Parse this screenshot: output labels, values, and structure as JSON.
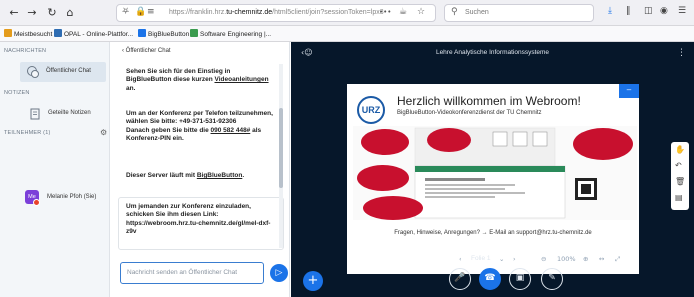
{
  "browser": {
    "back_icon": "arrow-left-icon",
    "forward_icon": "arrow-right-icon",
    "reload_icon": "reload-icon",
    "home_icon": "home-icon",
    "url_prefix": "https://franklin.hrz.",
    "url_domain": "tu-chemnitz.de",
    "url_rest": "/html5client/join?sessionToken=lpx3",
    "url_more": "•••",
    "search_placeholder": "Suchen",
    "bookmarks": [
      {
        "label": "Meistbesucht",
        "color": "#e49c1c"
      },
      {
        "label": "OPAL - Online-Plattfor...",
        "color": "#2f6db3"
      },
      {
        "label": "BigBlueButton",
        "color": "#1b73e8"
      },
      {
        "label": "Software Engineering |...",
        "color": "#3a9b4f"
      }
    ]
  },
  "sidebar": {
    "messages_header": "NACHRICHTEN",
    "public_chat_label": "Öffentlicher Chat",
    "notes_header": "NOTIZEN",
    "shared_notes_label": "Geteilte Notizen",
    "participants_header": "TEILNEHMER (1)",
    "user_initials": "Me",
    "user_name": "Melanie Pfoh (Sie)"
  },
  "chat": {
    "back_label": "‹  Öffentlicher Chat",
    "welcome_1": "Sehen Sie sich für den Einstieg in BigBlueButton diese kurzen ",
    "welcome_link": "Videoanleitungen",
    "welcome_2": " an.",
    "phone_1": "Um an der Konferenz per Telefon teilzunehmen, wählen Sie bitte: +49-371-531-92306",
    "phone_2": "Danach geben Sie bitte die ",
    "phone_pin_link": "090 582 448#",
    "phone_3": " als Konferenz-PIN ein.",
    "server_1": "Dieser Server läuft mit ",
    "server_link": "BigBlueButton",
    "server_2": ".",
    "invite_text": "Um jemanden zur Konferenz einzuladen, schicken Sie ihm diesen Link: https://webroom.hrz.tu-chemnitz.de/gl/mel-dxf-z9v",
    "input_placeholder": "Nachricht senden an Öffentlicher Chat"
  },
  "main": {
    "title": "Lehre Analytische Informationssysteme",
    "slide": {
      "logo_text": "URZ",
      "title": "Herzlich willkommen im Webroom!",
      "subtitle": "BigBlueButton-Videokonferenzdienst der TU Chemnitz",
      "footer": "Fragen, Hinweise, Anregungen? → E-Mail an support@hrz.tu-chemnitz.de",
      "minimize_label": "–"
    },
    "pager": {
      "prev": "‹",
      "page_label": "Folie 1",
      "next": "›",
      "zoom": "100%"
    }
  },
  "colors": {
    "accent": "#1b73e8",
    "dark_bg": "#06172a",
    "slide_red": "#c8102e"
  }
}
